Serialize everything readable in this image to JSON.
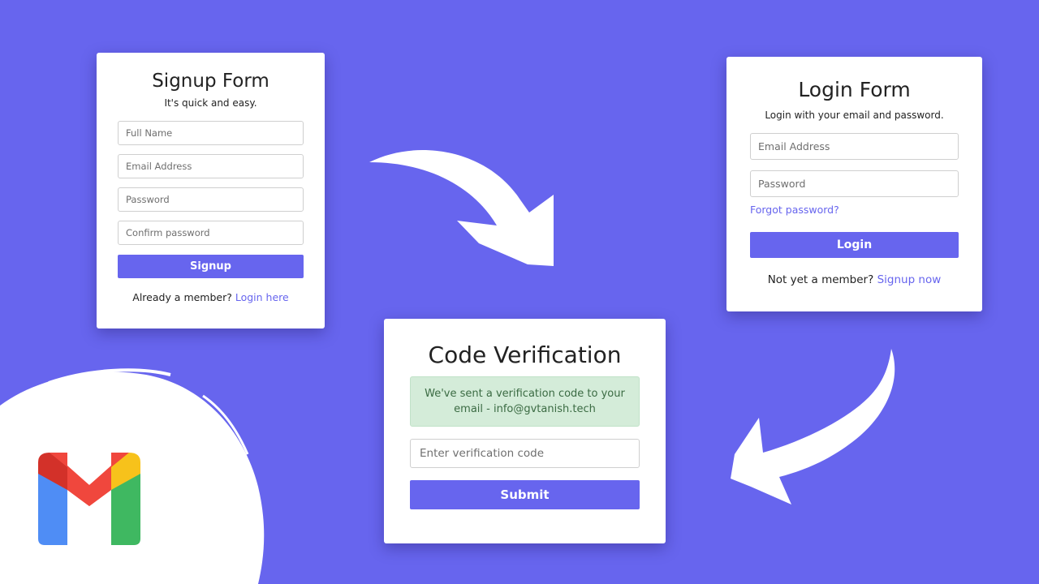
{
  "signup": {
    "title": "Signup Form",
    "subtitle": "It's quick and easy.",
    "fields": {
      "full_name": "Full Name",
      "email": "Email Address",
      "password": "Password",
      "confirm_password": "Confirm password"
    },
    "button": "Signup",
    "footer_text": "Already a member? ",
    "footer_link": "Login here"
  },
  "login": {
    "title": "Login Form",
    "subtitle": "Login with your email and password.",
    "fields": {
      "email": "Email Address",
      "password": "Password"
    },
    "forgot": "Forgot password?",
    "button": "Login",
    "footer_text": "Not yet a member? ",
    "footer_link": "Signup now"
  },
  "verify": {
    "title": "Code Verification",
    "notice_line1": "We've sent a verification code to your",
    "notice_line2": "email - info@gvtanish.tech",
    "field": "Enter verification code",
    "button": "Submit"
  },
  "icons": {
    "arrows": "curved-arrow-icon",
    "logo": "gmail-logo-icon"
  },
  "colors": {
    "background": "#6765ee",
    "accent": "#6765ee",
    "card": "#ffffff",
    "success_bg": "#d4ecd9",
    "success_text": "#3b6b43",
    "gmail_red": "#ea4335",
    "gmail_blue": "#4285f4",
    "gmail_green": "#34a853",
    "gmail_yellow": "#fbbc04"
  }
}
